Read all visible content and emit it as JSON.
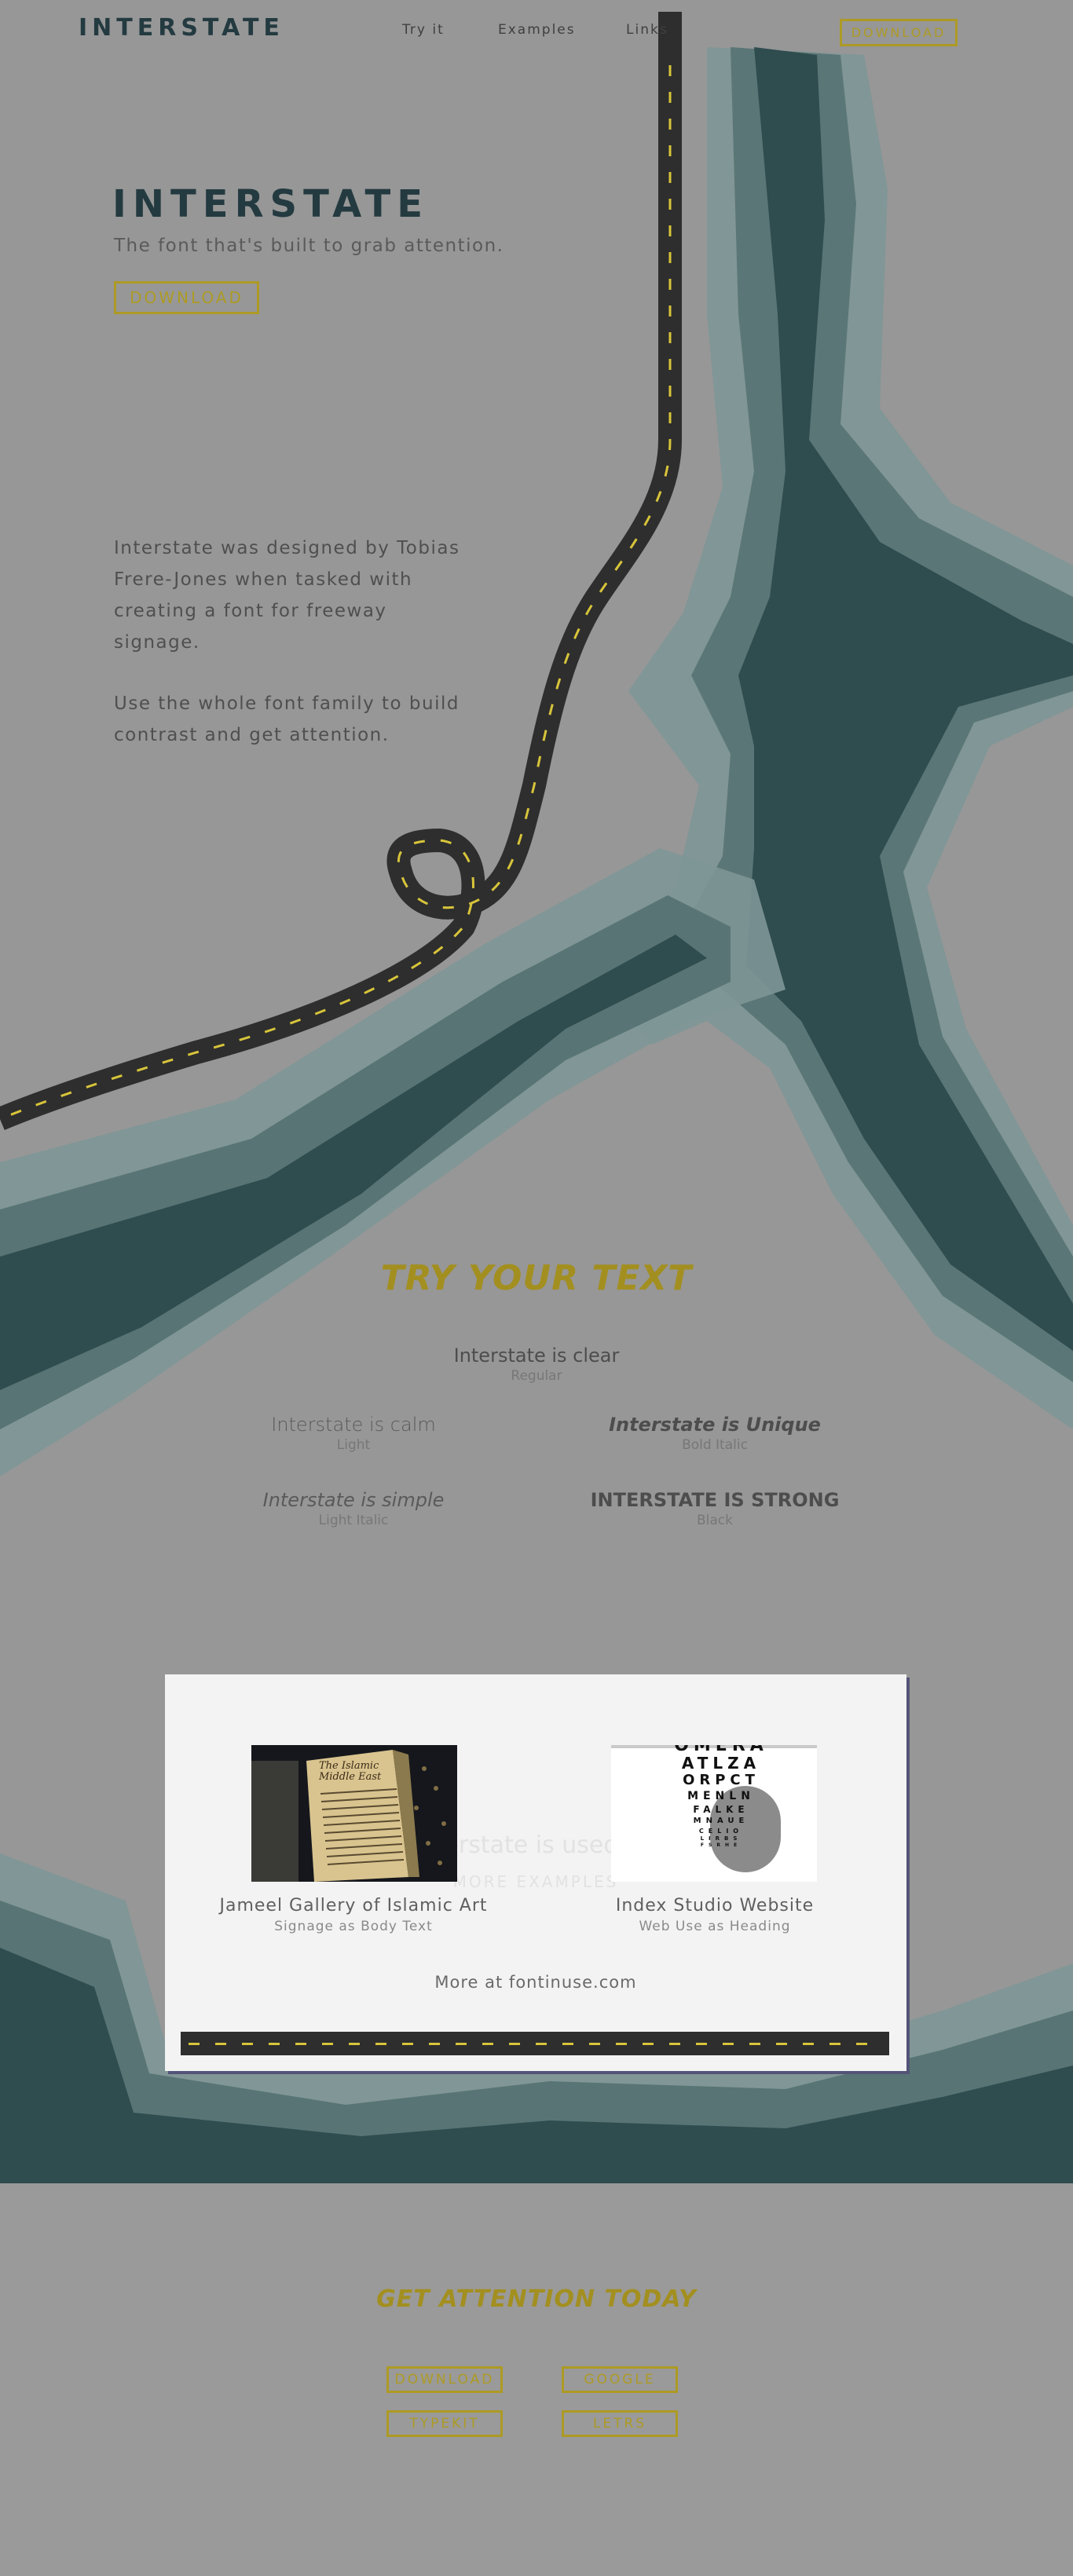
{
  "nav": {
    "brand": "INTERSTATE",
    "links": [
      "Try it",
      "Examples",
      "Links"
    ],
    "download": "DOWNLOAD"
  },
  "hero": {
    "title": "INTERSTATE",
    "subtitle": "The font that's built to grab attention.",
    "button": "DOWNLOAD",
    "paragraph1": "Interstate was designed by Tobias Frere-Jones when tasked with creating a font for freeway signage.",
    "paragraph2": "Use the whole font family to build contrast and get attention."
  },
  "try": {
    "title": "TRY YOUR TEXT",
    "samples": [
      {
        "text": "Interstate is clear",
        "weight": "Regular"
      },
      {
        "text": "Interstate is calm",
        "weight": "Light"
      },
      {
        "text": "Interstate is Unique",
        "weight": "Bold Italic"
      },
      {
        "text": "Interstate is simple",
        "weight": "Light Italic"
      },
      {
        "text": "INTERSTATE IS STRONG",
        "weight": "Black"
      }
    ]
  },
  "examples": {
    "ghost_heading": "Interstate is used for",
    "ghost_button": "MORE EXAMPLES",
    "items": [
      {
        "title": "Jameel Gallery of Islamic Art",
        "subtitle": "Signage as Body Text",
        "image_text": "The Islamic Middle East"
      },
      {
        "title": "Index Studio Website",
        "subtitle": "Web Use as Heading",
        "image_text": [
          "OMERA",
          "ATLZA",
          "ORPCT",
          "MENLN",
          "FALKE",
          "MNAUE",
          "CELIO",
          "LIRBS",
          "FSRHE"
        ]
      }
    ],
    "more": "More at fontinuse.com"
  },
  "footer": {
    "title": "GET ATTENTION TODAY",
    "buttons": [
      "DOWNLOAD",
      "GOOGLE",
      "TYPEKIT",
      "LETRS"
    ]
  },
  "colors": {
    "background": "#979797",
    "accent": "#ad9a24",
    "brand": "#233a40",
    "water_dark": "#2f4c4f",
    "water_mid": "#4f6e70",
    "water_light": "#7e9696",
    "road": "#2e2e2e",
    "road_dash": "#d7c43a"
  }
}
